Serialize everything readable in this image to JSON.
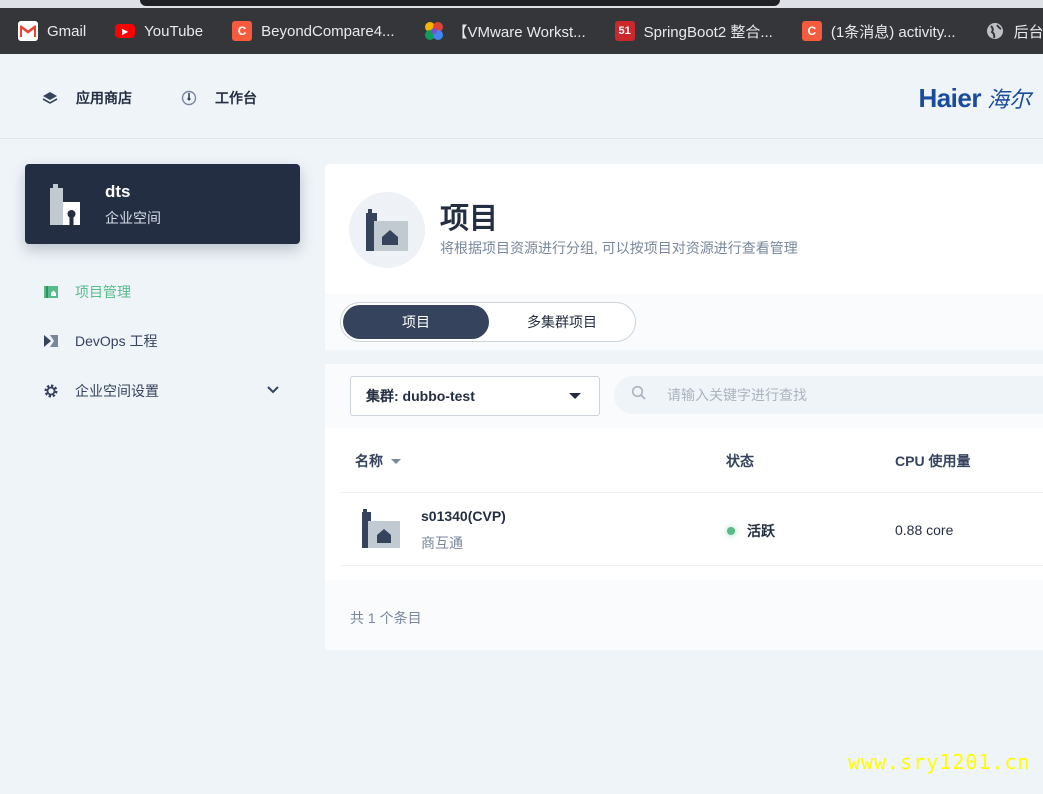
{
  "bookmarks": [
    {
      "label": "Gmail",
      "icon": "gmail-icon",
      "color": "#ea4335",
      "glyph": "M"
    },
    {
      "label": "YouTube",
      "icon": "youtube-icon",
      "color": "#ff0000",
      "glyph": "▶"
    },
    {
      "label": "BeyondCompare4...",
      "icon": "csdn-icon",
      "color": "#f55b3c",
      "glyph": "C"
    },
    {
      "label": "【VMware Workst...",
      "icon": "pinwheel-icon",
      "color": "#7a52c7",
      "glyph": "✿"
    },
    {
      "label": "SpringBoot2 整合...",
      "icon": "51cto-icon",
      "color": "#c9282d",
      "glyph": "51"
    },
    {
      "label": "(1条消息) activity...",
      "icon": "csdn-icon",
      "color": "#f55b3c",
      "glyph": "C"
    },
    {
      "label": "后台登",
      "icon": "globe-icon",
      "color": "#9aa0a6",
      "glyph": "◍"
    }
  ],
  "topnav": {
    "app_store": "应用商店",
    "workbench": "工作台",
    "logo_en": "Haier",
    "logo_cn": "海尔"
  },
  "workspace": {
    "name": "dts",
    "type": "企业空间"
  },
  "sidebar": {
    "items": [
      {
        "label": "项目管理",
        "active": true
      },
      {
        "label": "DevOps 工程",
        "active": false
      },
      {
        "label": "企业空间设置",
        "active": false
      }
    ]
  },
  "banner": {
    "title": "项目",
    "description": "将根据项目资源进行分组, 可以按项目对资源进行查看管理"
  },
  "tabs": {
    "projects": "项目",
    "multi_cluster": "多集群项目"
  },
  "toolbar": {
    "cluster_select": "集群: dubbo-test",
    "search_placeholder": "请输入关键字进行查找"
  },
  "table": {
    "columns": [
      "名称",
      "状态",
      "CPU 使用量"
    ],
    "rows": [
      {
        "name": "s01340(CVP)",
        "alias": "商互通",
        "status": "活跃",
        "cpu": "0.88 core"
      }
    ],
    "total": "共 1 个条目"
  },
  "colors": {
    "accent_green": "#55bc8a",
    "dark_navy": "#242e42",
    "brand_blue": "#1a4c9c"
  },
  "watermark": "www.sry1201.cn"
}
